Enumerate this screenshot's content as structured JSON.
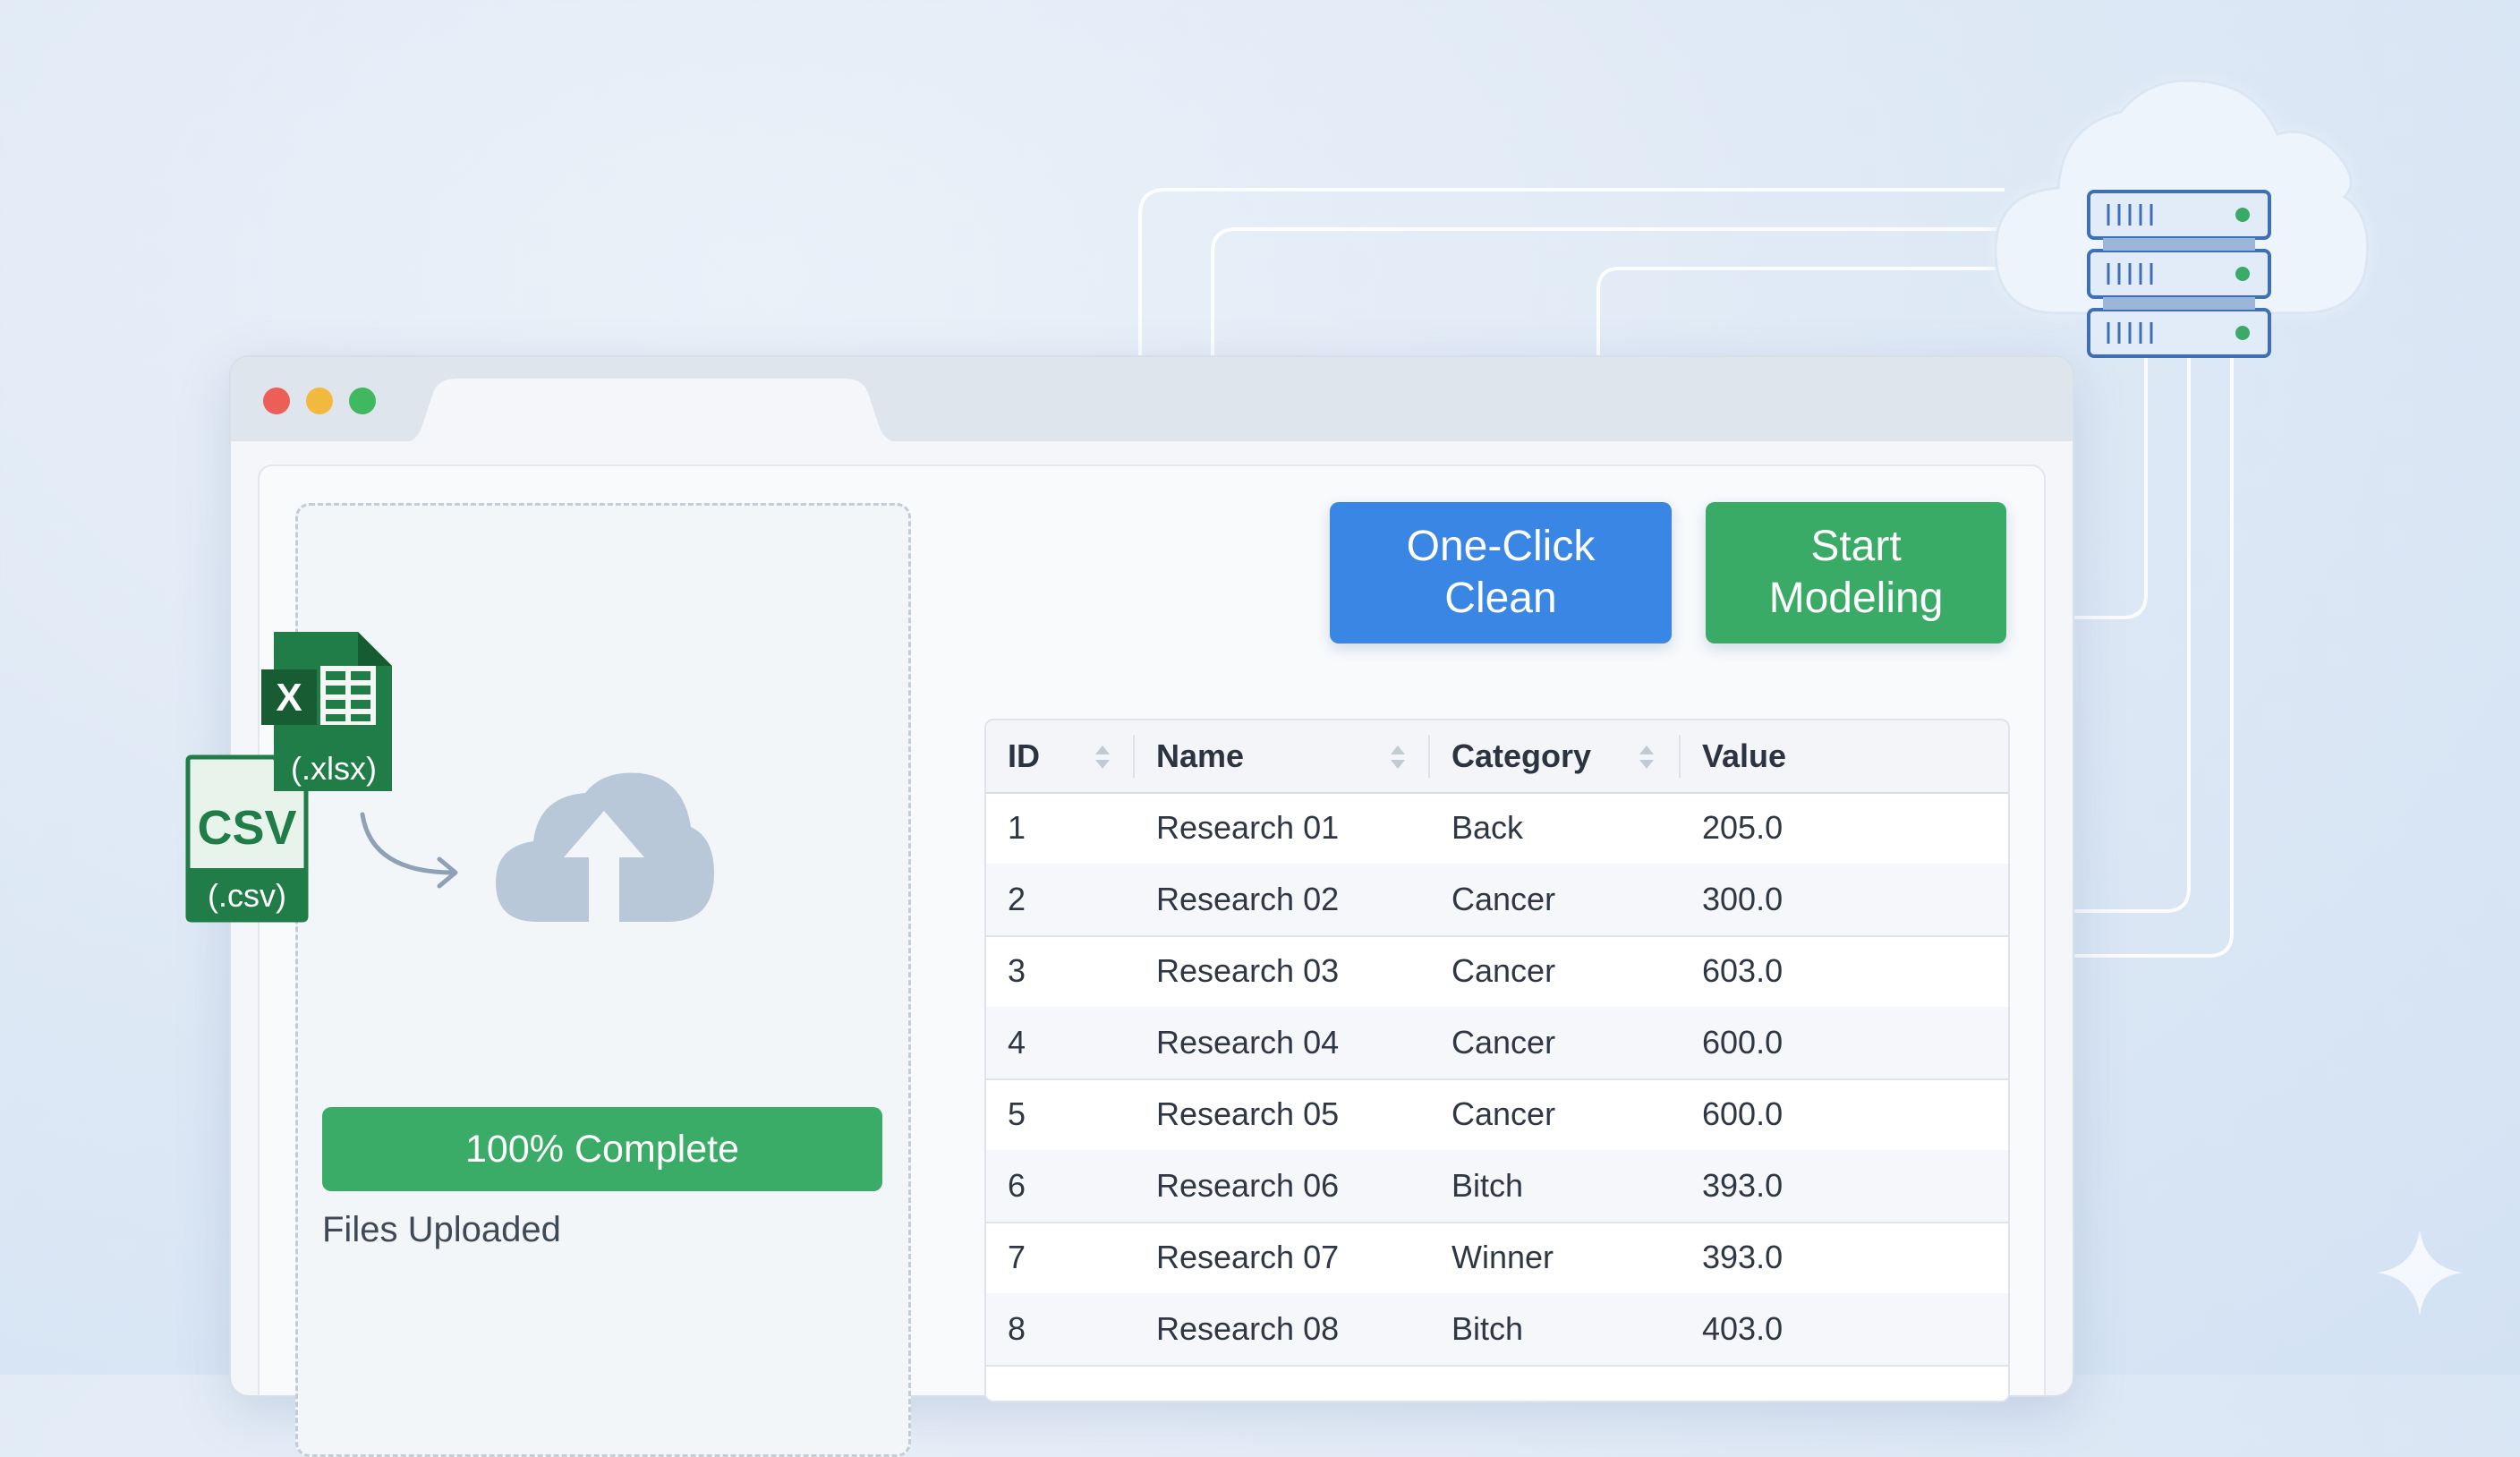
{
  "window": {
    "controls": [
      "close",
      "minimize",
      "maximize"
    ]
  },
  "upload": {
    "xlsx_ext": "(.xlsx)",
    "csv_badge": "CSV",
    "csv_ext": "(.csv)",
    "progress_percent": 100,
    "progress_label": "100% Complete",
    "status": "Files Uploaded"
  },
  "actions": {
    "clean_label": "One-Click Clean",
    "model_label": "Start Modeling"
  },
  "table": {
    "columns": [
      "ID",
      "Name",
      "Category",
      "Value"
    ],
    "rows": [
      [
        "1",
        "Research 01",
        "Back",
        "205.0"
      ],
      [
        "2",
        "Research 02",
        "Cancer",
        "300.0"
      ],
      [
        "3",
        "Research 03",
        "Cancer",
        "603.0"
      ],
      [
        "4",
        "Research 04",
        "Cancer",
        "600.0"
      ],
      [
        "5",
        "Research 05",
        "Cancer",
        "600.0"
      ],
      [
        "6",
        "Research 06",
        "Bitch",
        "393.0"
      ],
      [
        "7",
        "Research 07",
        "Winner",
        "393.0"
      ],
      [
        "8",
        "Research 08",
        "Bitch",
        "403.0"
      ]
    ]
  },
  "colors": {
    "clean_button": "#3a86e4",
    "model_button": "#3aab66",
    "progress": "#3aac67",
    "excel_green": "#217d47"
  },
  "icons": [
    "excel-file-icon",
    "csv-file-icon",
    "upload-cloud-icon",
    "cloud-server-icon",
    "sort-icon",
    "sparkle-icon"
  ]
}
